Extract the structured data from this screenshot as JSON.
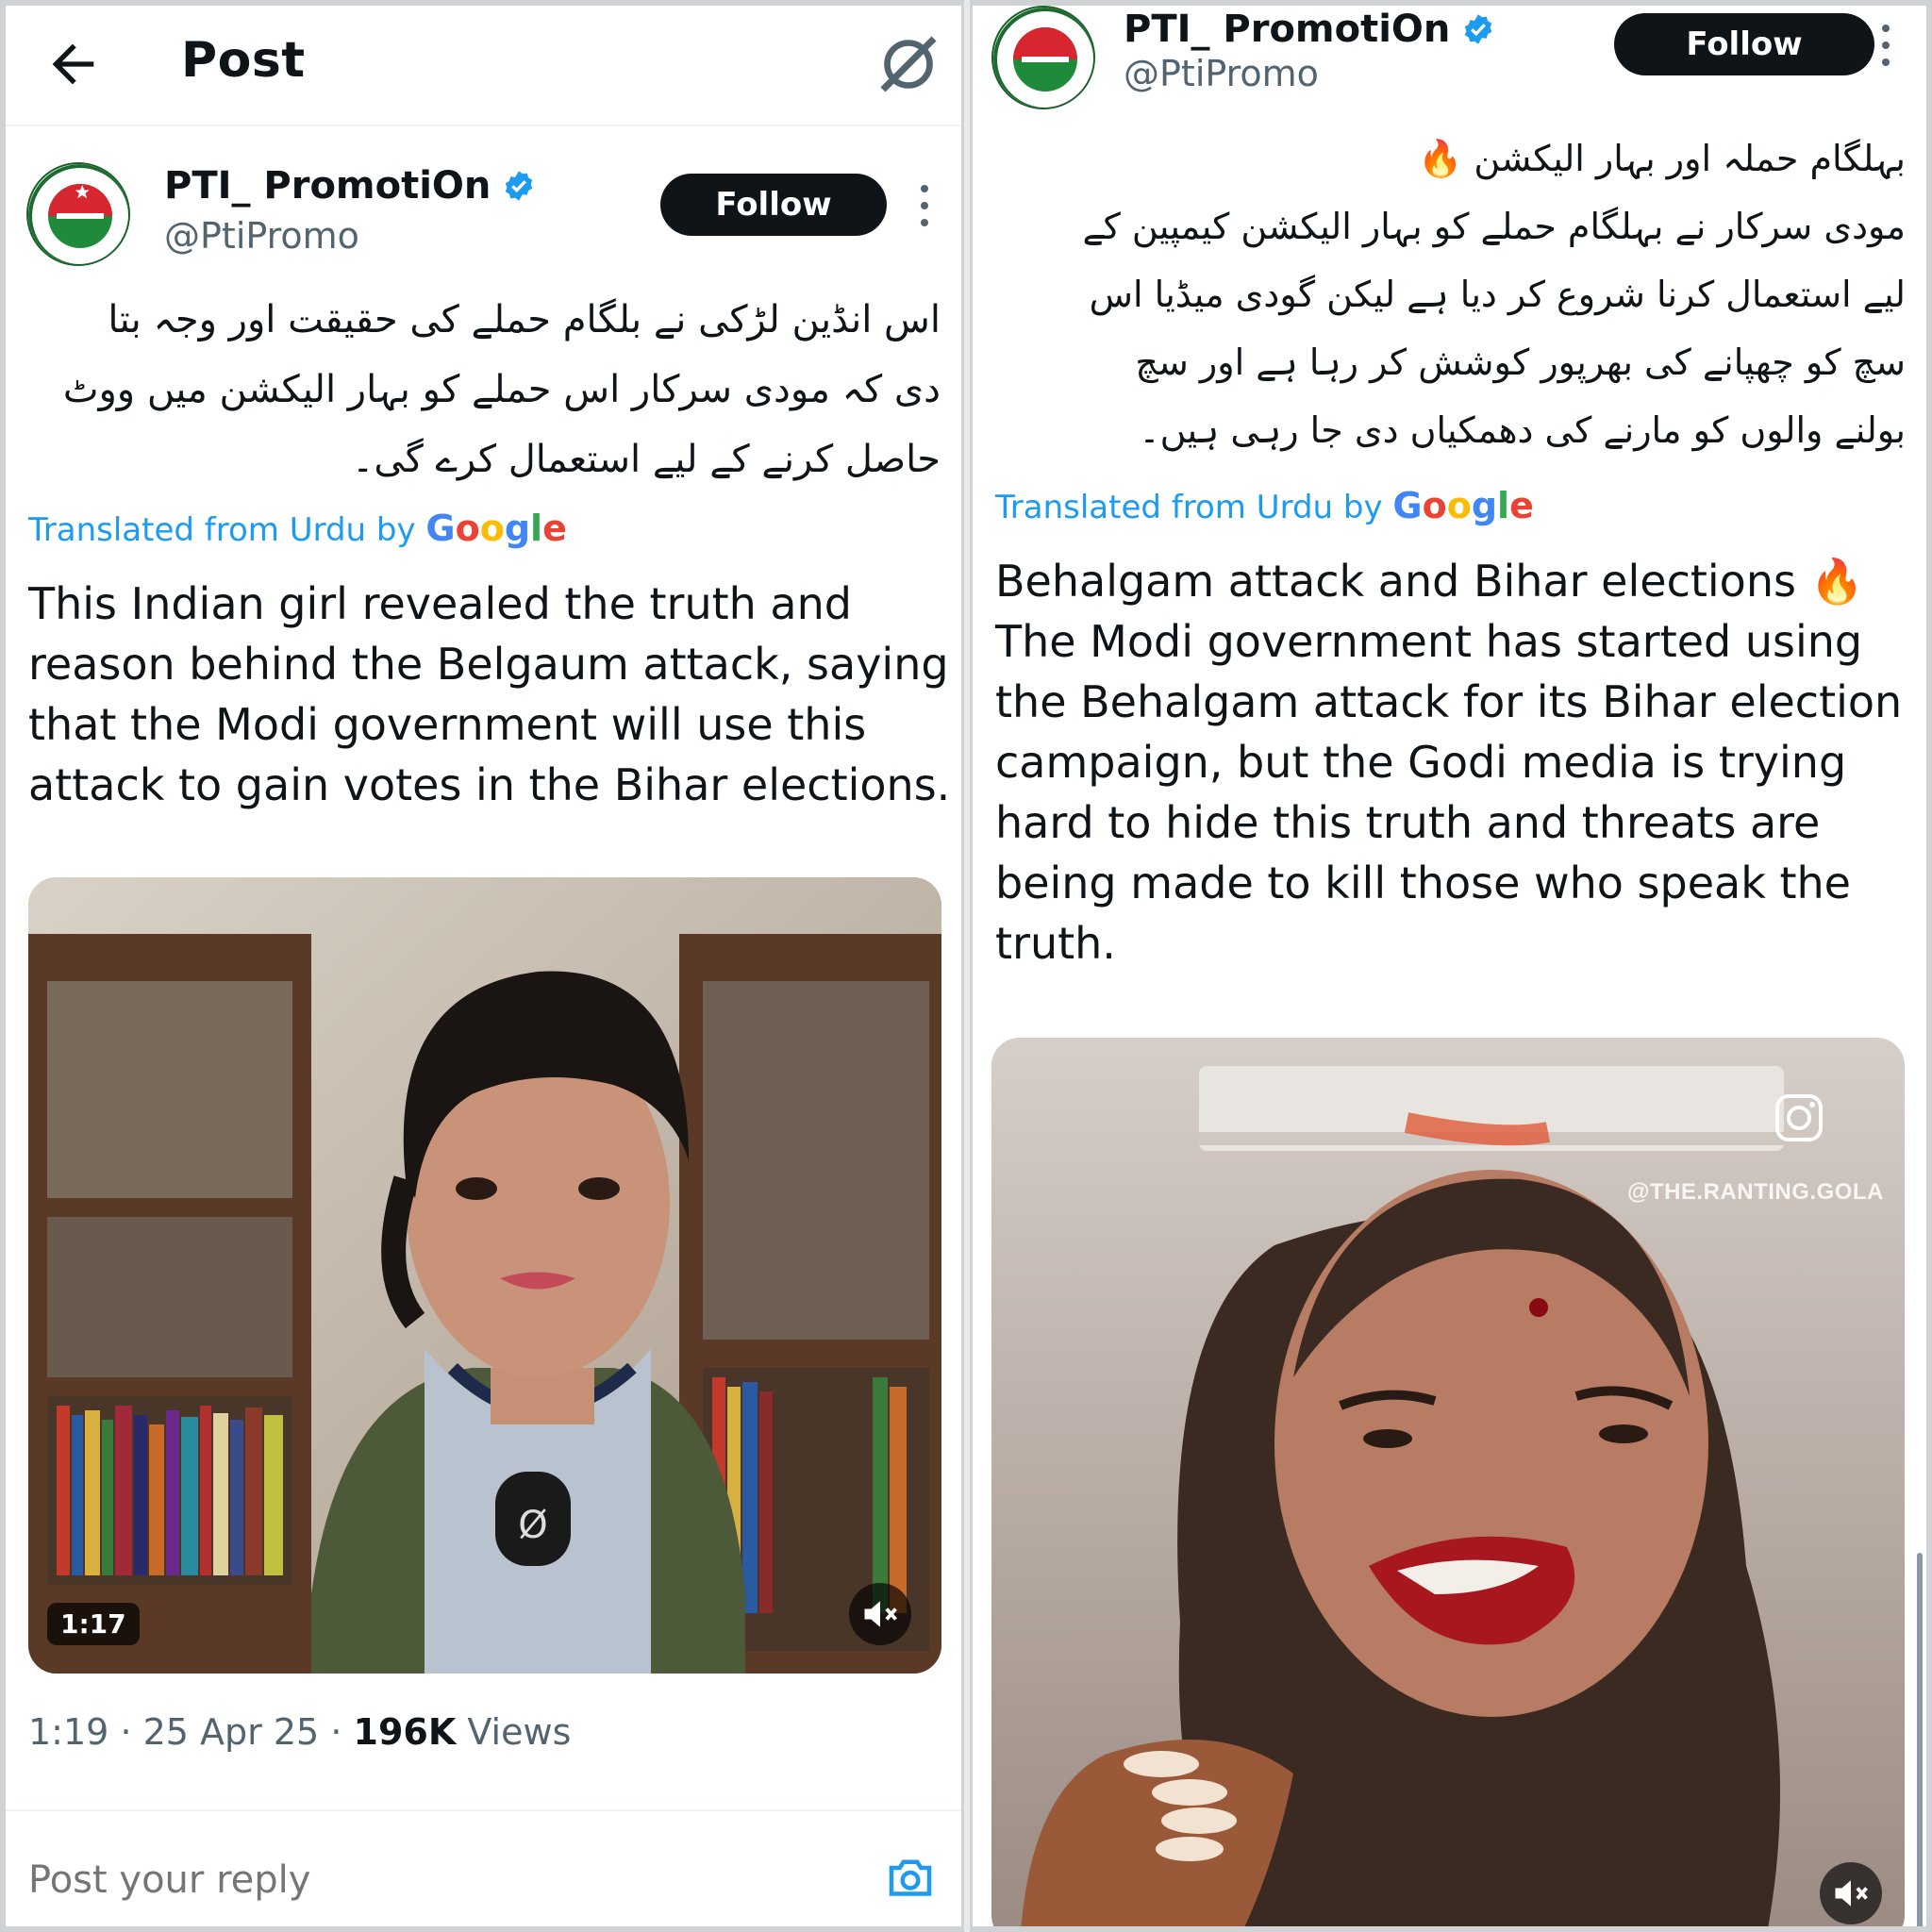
{
  "header": {
    "title": "Post"
  },
  "left_post": {
    "author_name": "PTI_ PromotiOn",
    "handle": "@PtiPromo",
    "follow_label": "Follow",
    "urdu_lines": [
      "اس انڈین لڑکی نے بلگام حملے کی حقیقت اور وجہ بتا",
      "دی کہ مودی سرکار اس حملے کو بہار الیکشن میں ووٹ",
      "حاصل کرنے کے لیے استعمال کرے گی۔"
    ],
    "translated_prefix": "Translated from Urdu by",
    "google": [
      "G",
      "o",
      "o",
      "g",
      "l",
      "e"
    ],
    "translation_lines": [
      "This Indian girl revealed the truth and",
      "reason behind the Belgaum attack, saying",
      "that the Modi government will use this",
      "attack to gain votes in the Bihar elections."
    ],
    "video_duration": "1:17",
    "mic_label": "Ø",
    "time": "1:19",
    "separator": "·",
    "date": "25 Apr 25",
    "views_count": "196K",
    "views_label": "Views",
    "reply_placeholder": "Post your reply"
  },
  "right_post": {
    "author_name": "PTI_ PromotiOn",
    "handle": "@PtiPromo",
    "follow_label": "Follow",
    "urdu_lines": [
      "بہلگام حملہ اور بہار الیکشن 🔥",
      "مودی سرکار نے بہلگام حملے کو بہار الیکشن کیمپین کے",
      "لیے استعمال کرنا شروع کر دیا ہے لیکن گودی میڈیا اس",
      "سچ کو چھپانے کی بھرپور کوشش کر رہا ہے اور سچ",
      "بولنے والوں کو مارنے کی دھمکیاں دی جا رہی ہیں۔"
    ],
    "translated_prefix": "Translated from Urdu by",
    "google": [
      "G",
      "o",
      "o",
      "g",
      "l",
      "e"
    ],
    "translation_lines": [
      "Behalgam attack and Bihar elections 🔥",
      "The Modi government has started using",
      "the Behalgam attack for its Bihar election",
      "campaign, but the Godi media is trying",
      "hard to hide this truth and threats are",
      "being made to kill those who speak the",
      "truth."
    ],
    "watermark": "@THE.RANTING.GOLA"
  },
  "colors": {
    "link_blue": "#1d9bf0",
    "text": "#0f1419",
    "muted": "#536471",
    "follow_bg": "#0f1419"
  }
}
